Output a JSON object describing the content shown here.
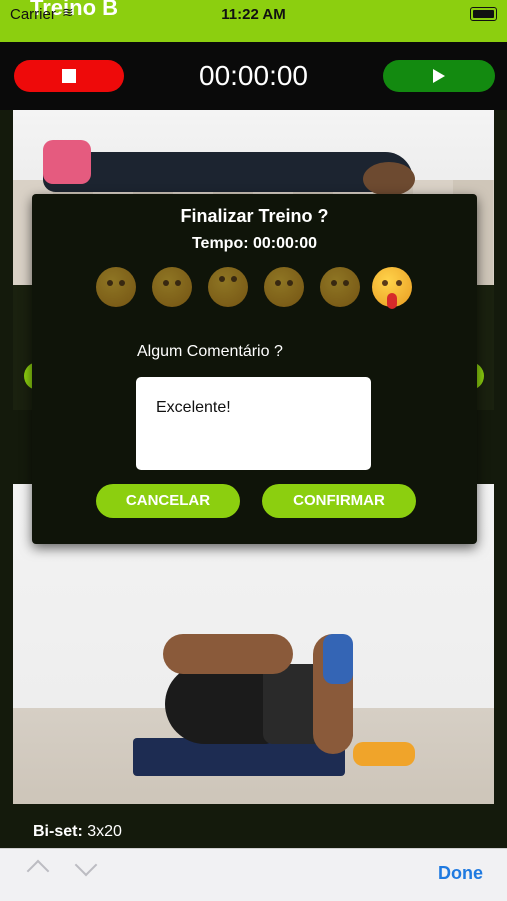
{
  "status_bar": {
    "carrier": "Carrier",
    "time": "11:22 AM",
    "title_behind": "Treino B"
  },
  "timer": {
    "display": "00:00:00",
    "stop_color": "#ee0a0a",
    "play_color": "#138a10"
  },
  "exercise": {
    "biset_label": "Bi-set:",
    "biset_value": "3x20"
  },
  "dialog": {
    "title": "Finalizar Treino ?",
    "tempo": "Tempo: 00:00:00",
    "emojis": [
      "neutral-face",
      "thinking-face",
      "rolling-eyes-face",
      "hushed-face",
      "sleepy-face",
      "exhausted-face-tongue"
    ],
    "selected_emoji": "exhausted-face-tongue",
    "comment_prompt": "Algum Comentário ?",
    "comment_value": "Excelente!",
    "cancel_label": "CANCELAR",
    "confirm_label": "CONFIRMAR",
    "accent": "#8ccf0f"
  },
  "keyboard_toolbar": {
    "done_label": "Done"
  }
}
